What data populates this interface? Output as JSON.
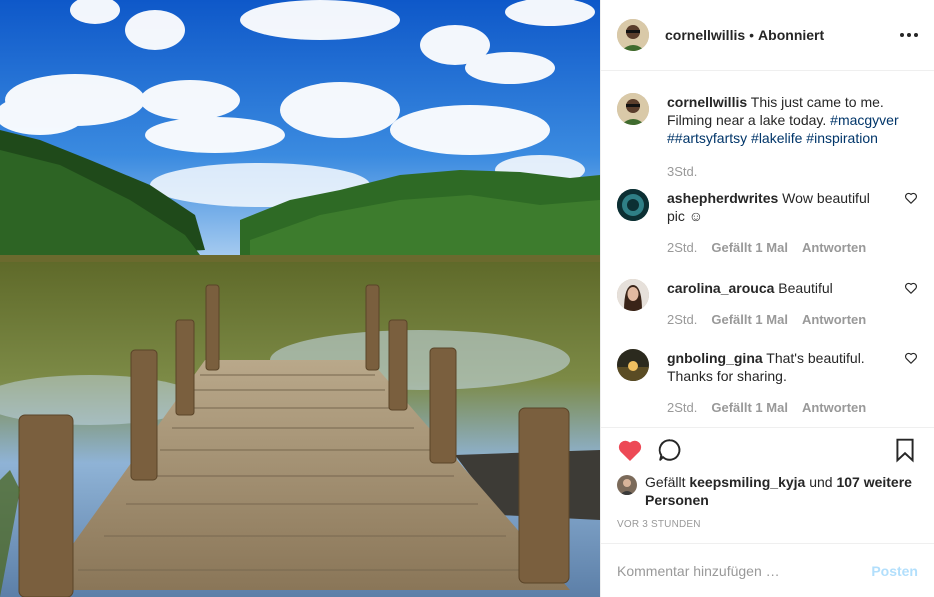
{
  "photo": {
    "alt_subject": "lake-with-wooden-dock"
  },
  "header": {
    "username": "cornellwillis",
    "separator": "•",
    "follow_status": "Abonniert"
  },
  "caption": {
    "username": "cornellwillis",
    "text": "This just came to me. Filming near a lake today.",
    "tags": [
      "#macgyver",
      "##artsyfartsy",
      "#lakelife",
      "#inspiration"
    ],
    "time": "3Std."
  },
  "comments": [
    {
      "username": "ashepherdwrites",
      "text": "Wow beautiful pic ☺︎",
      "time": "2Std.",
      "likes": "Gefällt 1 Mal",
      "reply": "Antworten"
    },
    {
      "username": "carolina_arouca",
      "text": "Beautiful",
      "time": "2Std.",
      "likes": "Gefällt 1 Mal",
      "reply": "Antworten"
    },
    {
      "username": "gnboling_gina",
      "text": "That's beautiful. Thanks for sharing.",
      "time": "2Std.",
      "likes": "Gefällt 1 Mal",
      "reply": "Antworten"
    }
  ],
  "likes": {
    "prefix": "Gefällt",
    "user": "keepsmiling_kyja",
    "connector": "und",
    "others": "107 weitere Personen"
  },
  "timestamp": "VOR 3 STUNDEN",
  "add_comment": {
    "placeholder": "Kommentar hinzufügen …",
    "post_label": "Posten"
  },
  "colors": {
    "like_red": "#ed4956",
    "link_blue": "#003569",
    "post_disabled": "#b2dffc",
    "muted": "#999999"
  }
}
